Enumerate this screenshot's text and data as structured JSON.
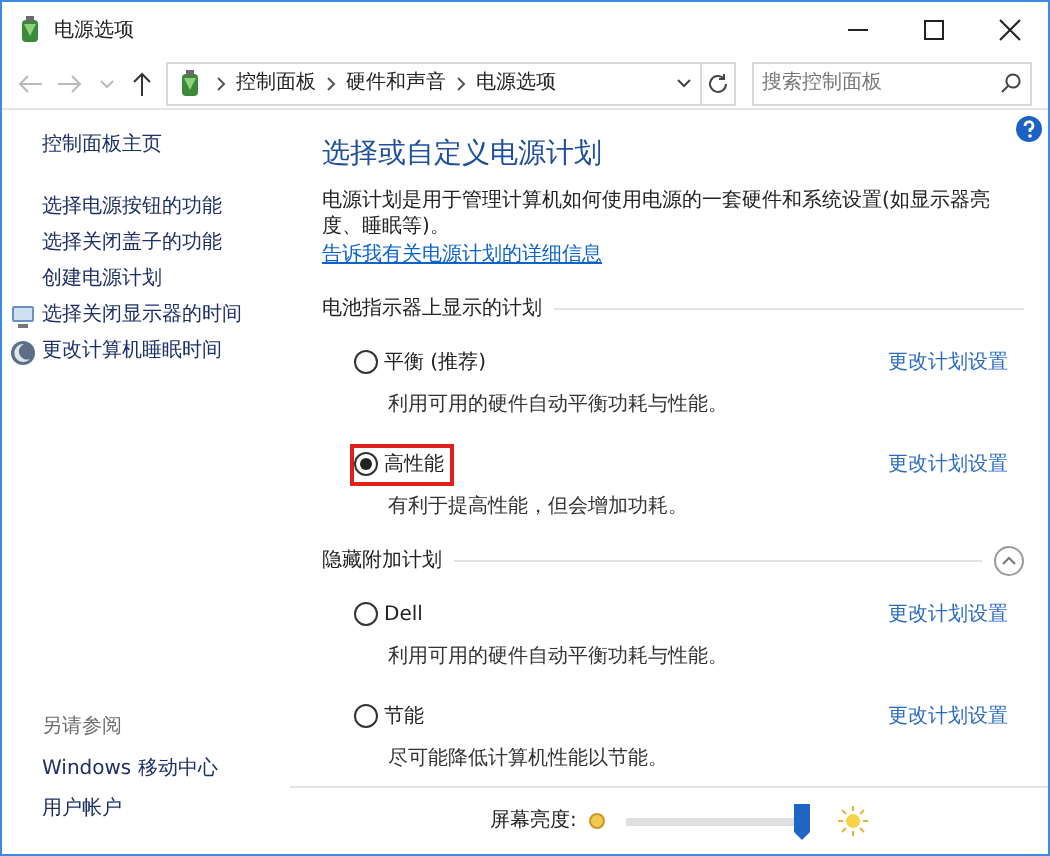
{
  "window": {
    "title": "电源选项"
  },
  "address_bar": {
    "breadcrumbs": [
      "控制面板",
      "硬件和声音",
      "电源选项"
    ]
  },
  "search": {
    "placeholder": "搜索控制面板"
  },
  "sidebar": {
    "home": "控制面板主页",
    "items": [
      {
        "label": "选择电源按钮的功能",
        "kind": "plain"
      },
      {
        "label": "选择关闭盖子的功能",
        "kind": "plain"
      },
      {
        "label": "创建电源计划",
        "kind": "plain"
      },
      {
        "label": "选择关闭显示器的时间",
        "kind": "display"
      },
      {
        "label": "更改计算机睡眠时间",
        "kind": "sleep"
      }
    ],
    "see_also": {
      "title": "另请参阅",
      "items": [
        "Windows 移动中心",
        "用户帐户"
      ]
    }
  },
  "main": {
    "heading": "选择或自定义电源计划",
    "description": "电源计划是用于管理计算机如何使用电源的一套硬件和系统设置(如显示器亮度、睡眠等)。",
    "description_link": "告诉我有关电源计划的详细信息",
    "groups": [
      {
        "title": "电池指示器上显示的计划",
        "collapsible": false,
        "plans": [
          {
            "name": "平衡 (推荐)",
            "description": "利用可用的硬件自动平衡功耗与性能。",
            "selected": false,
            "annotated": false,
            "link": "更改计划设置"
          },
          {
            "name": "高性能",
            "description": "有利于提高性能，但会增加功耗。",
            "selected": true,
            "annotated": true,
            "link": "更改计划设置"
          }
        ]
      },
      {
        "title": "隐藏附加计划",
        "collapsible": true,
        "plans": [
          {
            "name": "Dell",
            "description": "利用可用的硬件自动平衡功耗与性能。",
            "selected": false,
            "annotated": false,
            "link": "更改计划设置"
          },
          {
            "name": "节能",
            "description": "尽可能降低计算机性能以节能。",
            "selected": false,
            "annotated": false,
            "link": "更改计划设置"
          }
        ]
      }
    ]
  },
  "brightness": {
    "label": "屏幕亮度:",
    "level": 0.95
  }
}
